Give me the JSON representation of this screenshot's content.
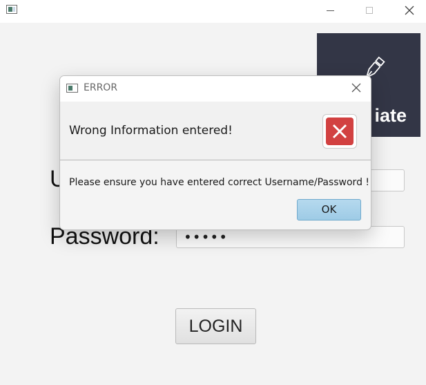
{
  "window": {
    "icon": "app-icon",
    "minimize_icon": "minimize-icon",
    "maximize_icon": "maximize-icon",
    "close_icon": "close-icon"
  },
  "logo": {
    "text": "iate",
    "icon": "pen-nib-icon",
    "background": "#333646"
  },
  "form": {
    "username_label": "U",
    "password_label": "Password:",
    "password_value": "•••••",
    "login_label": "LOGIN"
  },
  "dialog": {
    "title": "ERROR",
    "close_glyph": "✕",
    "header_text": "Wrong Information entered!",
    "content_text": "Please ensure you have entered correct Username/Password !",
    "ok_label": "OK",
    "error_icon": "error-x-icon",
    "error_color": "#d24141",
    "ok_color": "#a8d1ea"
  }
}
